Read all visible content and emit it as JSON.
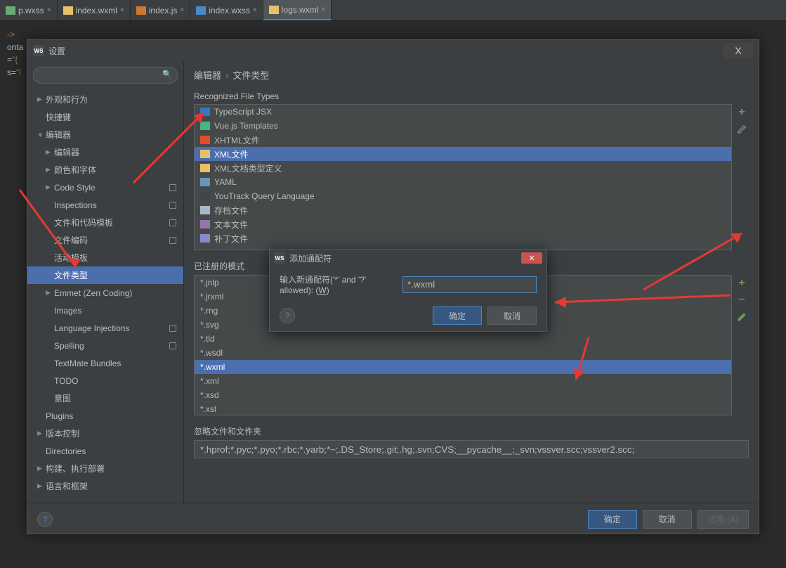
{
  "tabs": [
    {
      "label": "p.wxss",
      "cls": "wxss"
    },
    {
      "label": "index.wxml",
      "cls": "wxml"
    },
    {
      "label": "index.js",
      "cls": "js"
    },
    {
      "label": "index.wxss",
      "cls": "css"
    },
    {
      "label": "logs.wxml",
      "cls": "wxml",
      "active": true
    }
  ],
  "code": {
    "l1": "->",
    "l2": "onta",
    "l3a": "=",
    "l3b": "\"{",
    "l4a": "s=",
    "l4b": "\"l"
  },
  "dialog": {
    "title": "设置",
    "close": "X",
    "search_placeholder": "",
    "breadcrumb": {
      "a": "编辑器",
      "sep": "›",
      "b": "文件类型"
    },
    "tree": [
      {
        "label": "外观和行为",
        "level": 0,
        "exp": "closed"
      },
      {
        "label": "快捷键",
        "level": 0
      },
      {
        "label": "编辑器",
        "level": 0,
        "exp": "open"
      },
      {
        "label": "编辑器",
        "level": 1,
        "exp": "closed"
      },
      {
        "label": "颜色和字体",
        "level": 1,
        "exp": "closed"
      },
      {
        "label": "Code Style",
        "level": 1,
        "exp": "closed",
        "badge": true
      },
      {
        "label": "Inspections",
        "level": 1,
        "badge": true
      },
      {
        "label": "文件和代码模板",
        "level": 1,
        "badge": true
      },
      {
        "label": "文件编码",
        "level": 1,
        "badge": true
      },
      {
        "label": "活动模板",
        "level": 1
      },
      {
        "label": "文件类型",
        "level": 1,
        "sel": true
      },
      {
        "label": "Emmet (Zen Coding)",
        "level": 1,
        "exp": "closed"
      },
      {
        "label": "Images",
        "level": 1
      },
      {
        "label": "Language Injections",
        "level": 1,
        "badge": true
      },
      {
        "label": "Spelling",
        "level": 1,
        "badge": true
      },
      {
        "label": "TextMate Bundles",
        "level": 1
      },
      {
        "label": "TODO",
        "level": 1
      },
      {
        "label": "意图",
        "level": 1
      },
      {
        "label": "Plugins",
        "level": 0
      },
      {
        "label": "版本控制",
        "level": 0,
        "exp": "closed"
      },
      {
        "label": "Directories",
        "level": 0
      },
      {
        "label": "构建、执行部署",
        "level": 0,
        "exp": "closed"
      },
      {
        "label": "语言和框架",
        "level": 0,
        "exp": "closed"
      }
    ],
    "section_recognized": "Recognized File Types",
    "file_types": [
      {
        "label": "TypeScript JSX",
        "cls": "ts"
      },
      {
        "label": "Vue.js Templates",
        "cls": "vue"
      },
      {
        "label": "XHTML文件",
        "cls": "html"
      },
      {
        "label": "XML文件",
        "cls": "xml",
        "sel": true
      },
      {
        "label": "XML文档类型定义",
        "cls": "xml"
      },
      {
        "label": "YAML",
        "cls": "yaml"
      },
      {
        "label": "YouTrack Query Language",
        "cls": "yt"
      },
      {
        "label": "存档文件",
        "cls": "bin"
      },
      {
        "label": "文本文件",
        "cls": "txt"
      },
      {
        "label": "补丁文件",
        "cls": "patch"
      }
    ],
    "section_registered": "已注册的模式",
    "patterns": [
      "*.jnlp",
      "*.jrxml",
      "*.rng",
      "*.svg",
      "*.tld",
      "*.wsdl",
      "*.wxml",
      "*.xml",
      "*.xsd",
      "*.xsl"
    ],
    "patterns_selected": "*.wxml",
    "section_ignore": "忽略文件和文件夹",
    "ignore_value": "*.hprof;*.pyc;*.pyo;*.rbc;*.yarb;*~;.DS_Store;.git;.hg;.svn;CVS;__pycache__;_svn;vssver.scc;vssver2.scc;",
    "ok": "确定",
    "cancel": "取消",
    "apply": "应用 (A)",
    "help": "?",
    "action_plus": "+",
    "action_minus": "−",
    "action_edit_title": "edit"
  },
  "inner": {
    "title": "添加通配符",
    "label_a": "输入新通配符('*' and '?' allowed): (",
    "label_u": "W",
    "label_b": ")",
    "value": "*.wxml",
    "ok": "确定",
    "cancel": "取消",
    "help": "?"
  }
}
